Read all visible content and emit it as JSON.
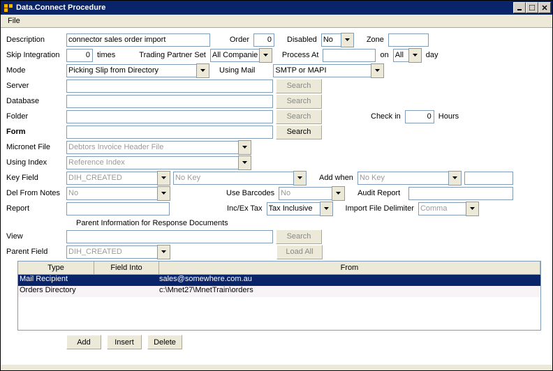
{
  "window": {
    "title": "Data.Connect Procedure"
  },
  "menu": {
    "file": "File"
  },
  "labels": {
    "description": "Description",
    "order": "Order",
    "disabled": "Disabled",
    "zone": "Zone",
    "skip_integration": "Skip Integration",
    "times": "times",
    "trading_partner_set": "Trading Partner Set",
    "process_at": "Process At",
    "on": "on",
    "day": "day",
    "mode": "Mode",
    "using_mail": "Using Mail",
    "server": "Server",
    "database": "Database",
    "folder": "Folder",
    "check_in": "Check in",
    "hours": "Hours",
    "form": "Form",
    "micronet_file": "Micronet File",
    "using_index": "Using Index",
    "key_field": "Key Field",
    "add_when": "Add when",
    "del_from_notes": "Del From Notes",
    "use_barcodes": "Use Barcodes",
    "audit_report": "Audit Report",
    "report": "Report",
    "inc_ex_tax": "Inc/Ex Tax",
    "import_file_delimiter": "Import File Delimiter",
    "parent_info": "Parent Information for Response Documents",
    "view": "View",
    "parent_field": "Parent Field",
    "grid_type": "Type",
    "grid_field_into": "Field Into",
    "grid_from": "From"
  },
  "values": {
    "description": "connector sales order import",
    "order": "0",
    "disabled": "No",
    "zone": "",
    "skip_integration": "0",
    "trading_partner_set": "All Companies",
    "process_at": "",
    "on": "All",
    "mode": "Picking Slip from Directory",
    "using_mail": "SMTP or MAPI",
    "server": "",
    "database": "",
    "folder": "",
    "check_in": "0",
    "form": "",
    "micronet_file": "Debtors Invoice Header File",
    "using_index": "Reference Index",
    "key_field": "DIH_CREATED",
    "key_field_extra": "No Key",
    "add_when": "No Key",
    "add_when_extra": "",
    "del_from_notes": "No",
    "use_barcodes": "No",
    "audit_report": "",
    "report": "",
    "inc_ex_tax": "Tax Inclusive",
    "import_file_delimiter": "Comma",
    "view": "",
    "parent_field": "DIH_CREATED"
  },
  "buttons": {
    "search": "Search",
    "load_all": "Load All",
    "add": "Add",
    "insert": "Insert",
    "delete": "Delete"
  },
  "grid": {
    "rows": [
      {
        "type": "Mail Recipient",
        "field_into": "",
        "from": "sales@somewhere.com.au"
      },
      {
        "type": "Orders Directory",
        "field_into": "",
        "from": "c:\\Mnet27\\MnetTrain\\orders"
      }
    ]
  }
}
